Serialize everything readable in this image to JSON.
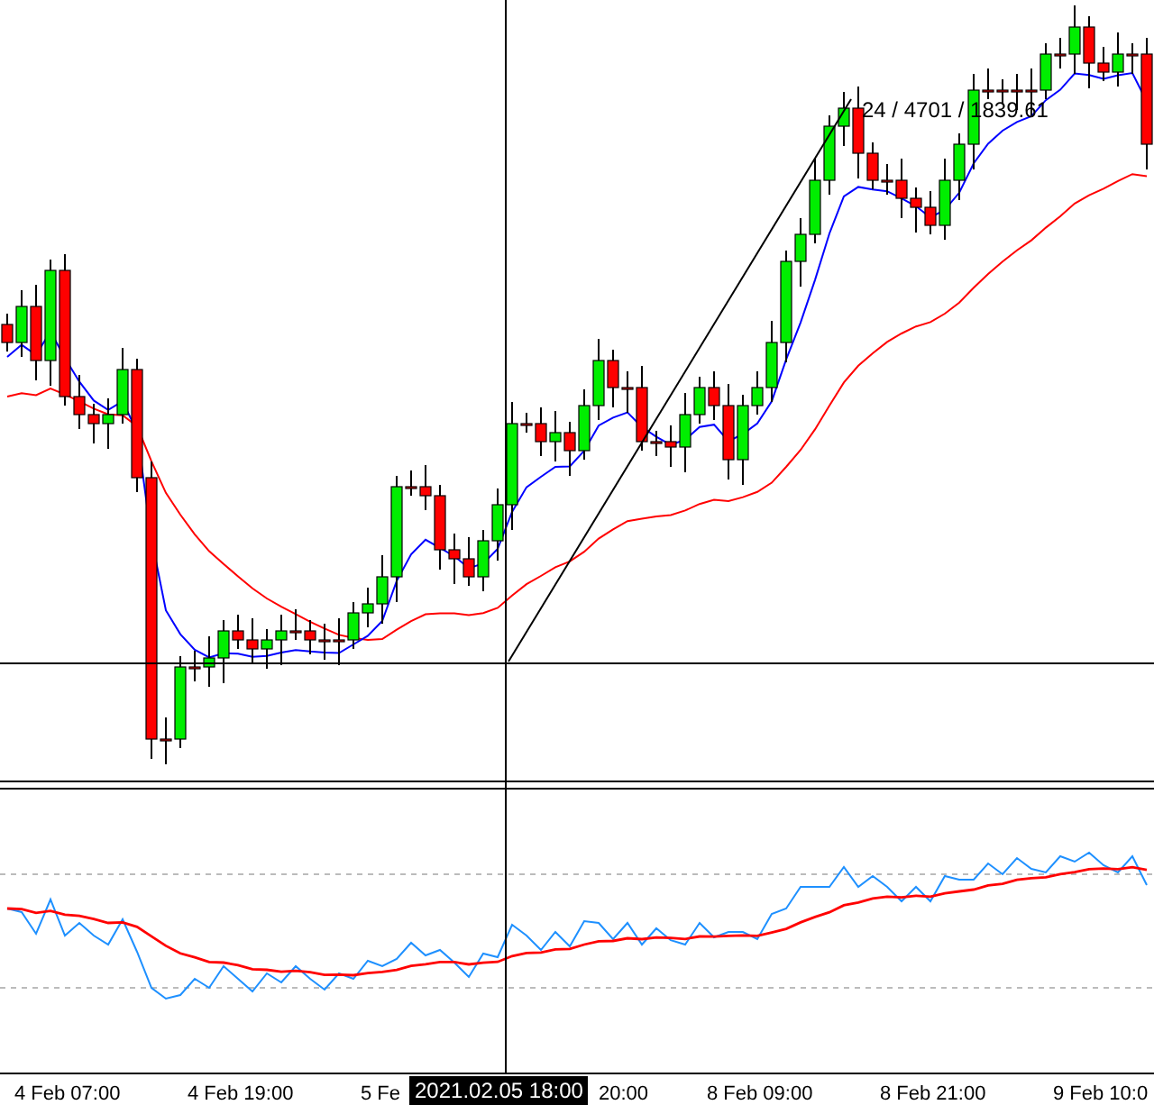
{
  "chart": {
    "ruler_label": "24 / 4701 / 1839.61",
    "crosshair_time": "2021.02.05 18:00"
  },
  "time_axis": [
    {
      "label": "4 Feb 07:00",
      "kind": "full"
    },
    {
      "label": "4 Feb 19:00",
      "kind": "full"
    },
    {
      "label": "5 Fe",
      "kind": "full"
    },
    {
      "label": "20:00",
      "kind": "tail"
    },
    {
      "label": "8 Feb 09:00",
      "kind": "full"
    },
    {
      "label": "8 Feb 21:00",
      "kind": "full"
    },
    {
      "label": "9 Feb 10:0",
      "kind": "full"
    }
  ]
}
